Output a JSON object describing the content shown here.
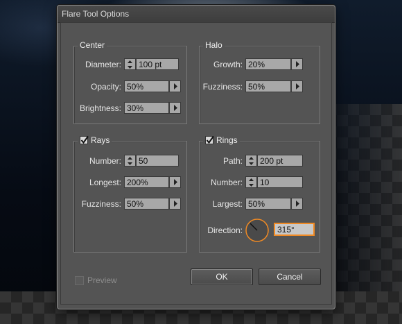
{
  "dialog": {
    "title": "Flare Tool Options"
  },
  "center": {
    "title": "Center",
    "diameter_label": "Diameter:",
    "diameter_value": "100 pt",
    "opacity_label": "Opacity:",
    "opacity_value": "50%",
    "brightness_label": "Brightness:",
    "brightness_value": "30%"
  },
  "halo": {
    "title": "Halo",
    "growth_label": "Growth:",
    "growth_value": "20%",
    "fuzziness_label": "Fuzziness:",
    "fuzziness_value": "50%"
  },
  "rays": {
    "title": "Rays",
    "checked": true,
    "number_label": "Number:",
    "number_value": "50",
    "longest_label": "Longest:",
    "longest_value": "200%",
    "fuzziness_label": "Fuzziness:",
    "fuzziness_value": "50%"
  },
  "rings": {
    "title": "Rings",
    "checked": true,
    "path_label": "Path:",
    "path_value": "200 pt",
    "number_label": "Number:",
    "number_value": "10",
    "largest_label": "Largest:",
    "largest_value": "50%",
    "direction_label": "Direction:",
    "direction_value": "315°"
  },
  "footer": {
    "preview_label": "Preview",
    "preview_checked": false,
    "ok_label": "OK",
    "cancel_label": "Cancel"
  },
  "colors": {
    "dialog_bg": "#535353",
    "field_bg": "#a8a8a8",
    "accent": "#f08a24"
  },
  "icons": {
    "stepper": "up-down-arrows-icon",
    "dropdown": "triangle-right-icon",
    "checkbox": "checkmark-icon",
    "dial": "angle-dial-icon"
  }
}
